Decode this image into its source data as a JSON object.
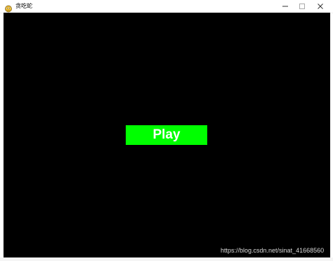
{
  "window": {
    "title": "贪吃蛇",
    "app_icon": "pygame-snake-icon",
    "controls": {
      "minimize": "—",
      "maximize": "☐",
      "close": "✕"
    }
  },
  "game": {
    "background_color": "#000000",
    "play_button": {
      "label": "Play",
      "background_color": "#00ff00",
      "text_color": "#ffffff"
    }
  },
  "watermark": {
    "text": "https://blog.csdn.net/sinat_41668560"
  },
  "colors": {
    "titlebar": "#ffffff",
    "canvas": "#000000",
    "accent": "#00ff00"
  }
}
